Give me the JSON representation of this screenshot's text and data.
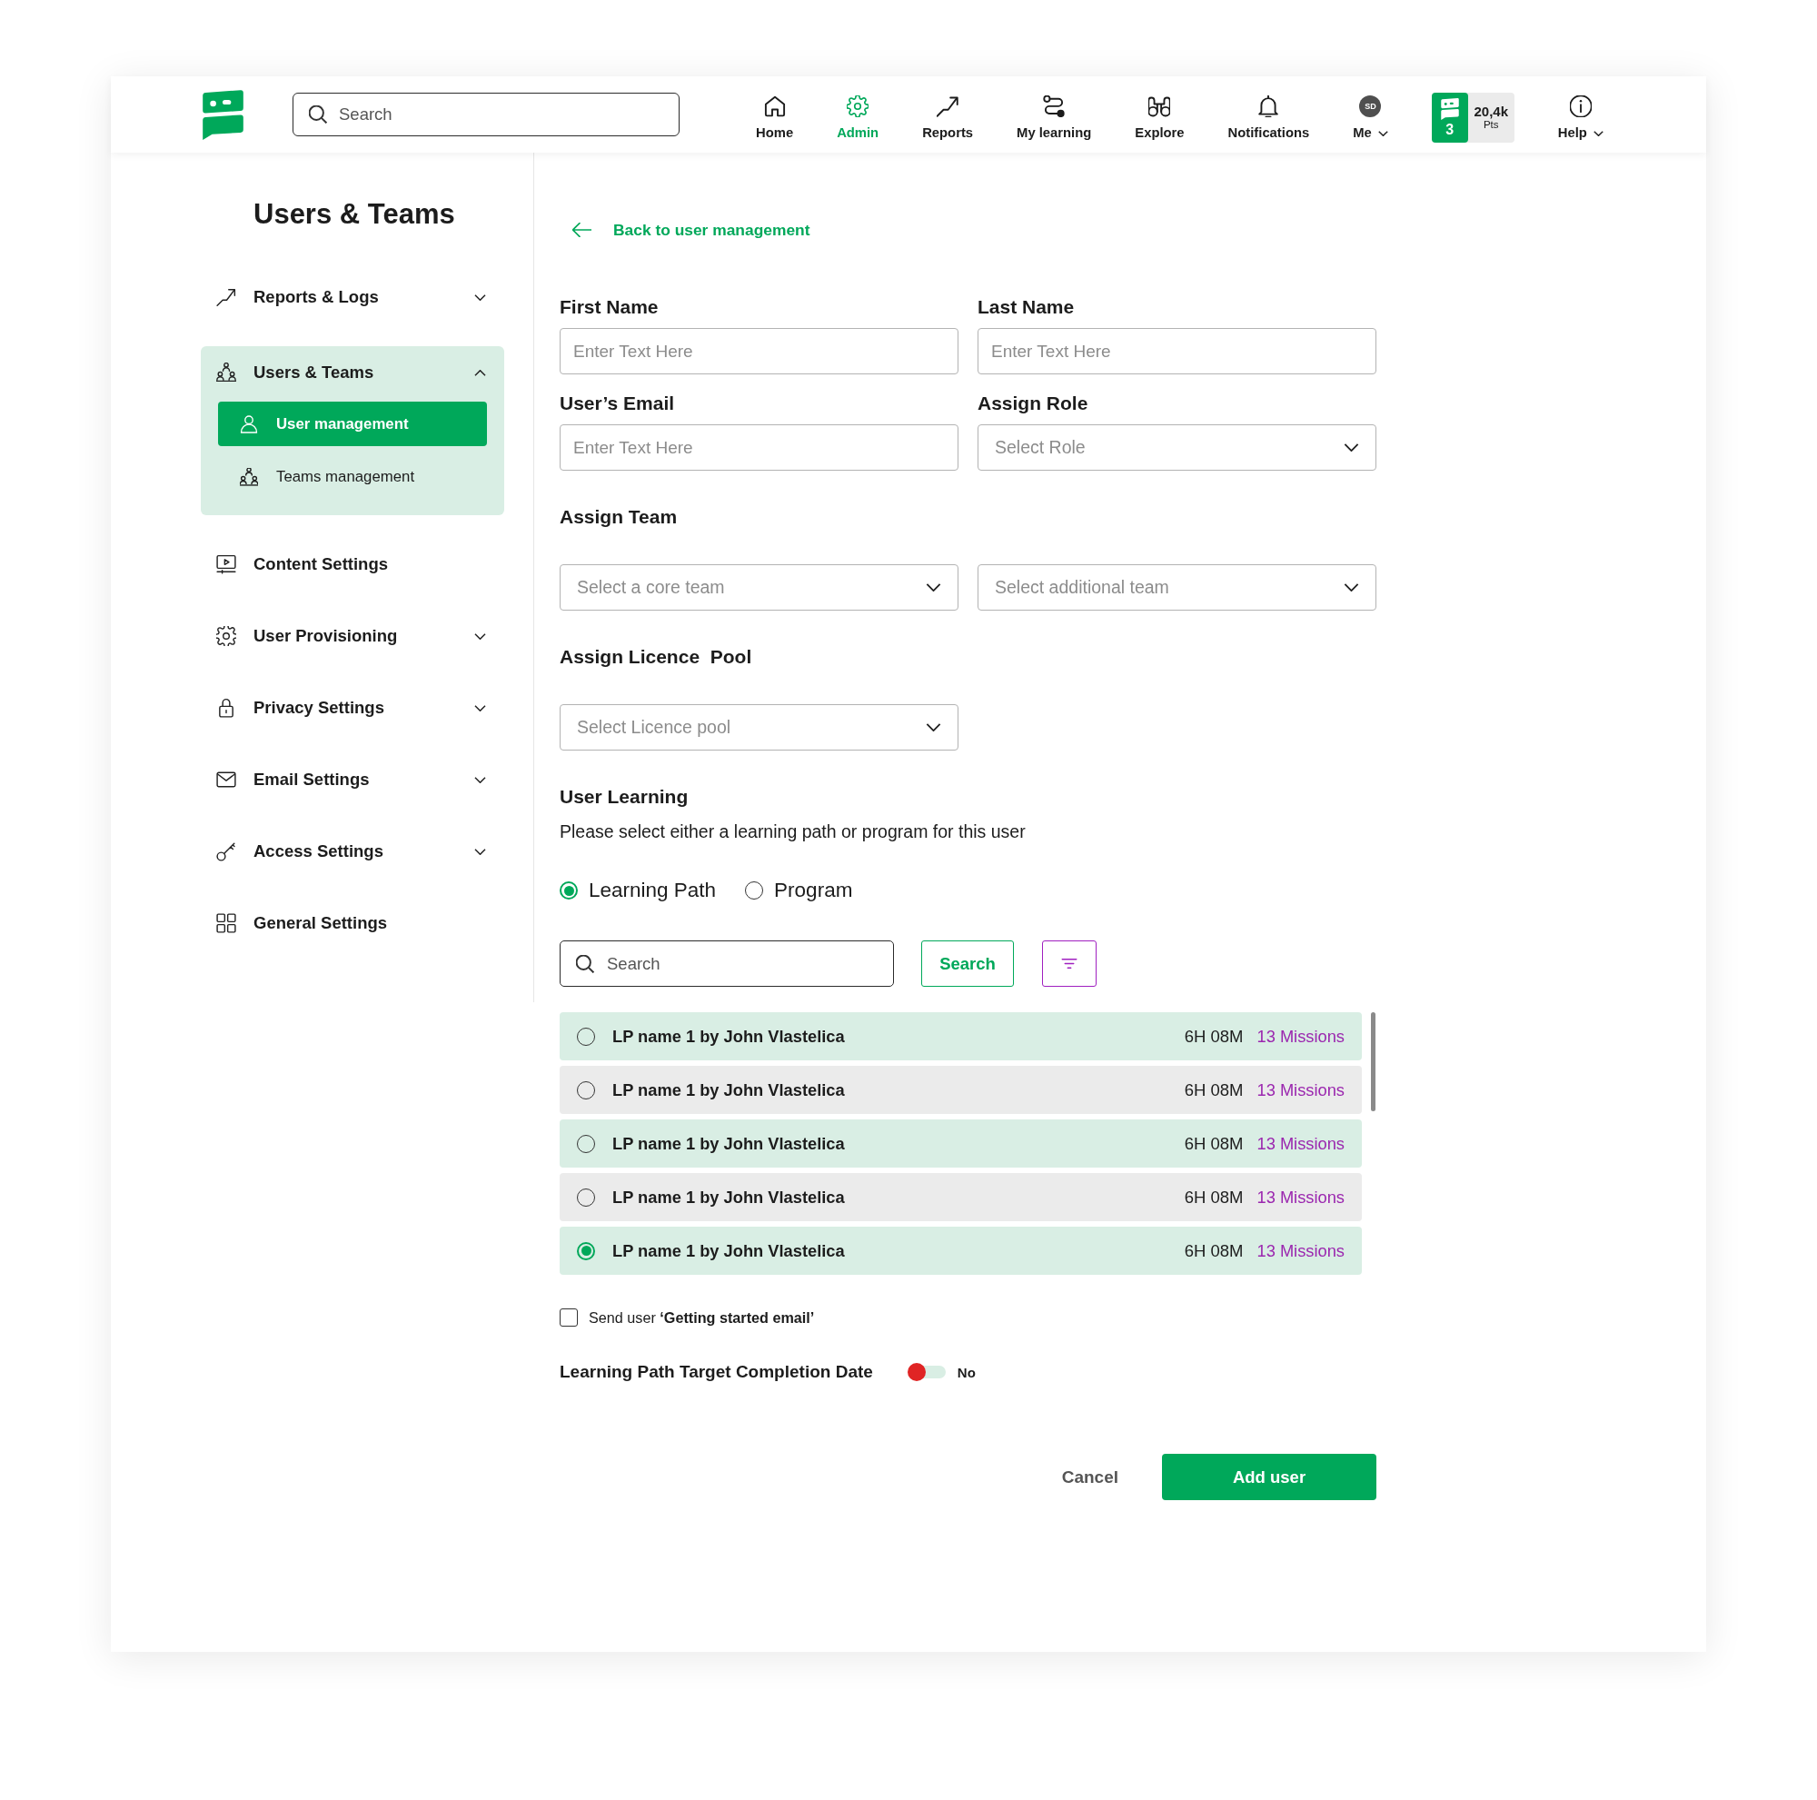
{
  "header": {
    "search": {
      "placeholder": "Search"
    },
    "nav": [
      {
        "label": "Home",
        "kind": "icon",
        "selected": false,
        "dropdown": false
      },
      {
        "label": "Admin",
        "kind": "icon",
        "selected": true,
        "dropdown": false
      },
      {
        "label": "Reports",
        "kind": "icon",
        "selected": false,
        "dropdown": false
      },
      {
        "label": "My learning",
        "kind": "icon",
        "selected": false,
        "dropdown": false
      },
      {
        "label": "Explore",
        "kind": "icon",
        "selected": false,
        "dropdown": false
      },
      {
        "label": "Notifications",
        "kind": "icon",
        "selected": false,
        "dropdown": false
      },
      {
        "label": "Me",
        "kind": "avatar",
        "initials": "SD",
        "selected": false,
        "dropdown": true
      }
    ],
    "points": {
      "badge": "3",
      "value": "20,4k",
      "unit": "Pts"
    },
    "help": {
      "label": "Help",
      "selected": false,
      "dropdown": true
    }
  },
  "sidebar": {
    "title": "Users & Teams",
    "items": [
      {
        "label": "Reports & Logs",
        "expandable": true,
        "expanded": false
      },
      {
        "label": "Users & Teams",
        "expandable": true,
        "expanded": true,
        "children": [
          {
            "label": "User management",
            "selected": true
          },
          {
            "label": "Teams management",
            "selected": false
          }
        ]
      },
      {
        "label": "Content Settings",
        "expandable": false,
        "expanded": false
      },
      {
        "label": "User Provisioning",
        "expandable": true,
        "expanded": false
      },
      {
        "label": "Privacy Settings",
        "expandable": true,
        "expanded": false
      },
      {
        "label": "Email Settings",
        "expandable": true,
        "expanded": false
      },
      {
        "label": "Access Settings",
        "expandable": true,
        "expanded": false
      },
      {
        "label": "General Settings",
        "expandable": false,
        "expanded": false
      }
    ]
  },
  "back_link": {
    "label": "Back to user management"
  },
  "form": {
    "fields": [
      {
        "label": "First Name",
        "kind": "text",
        "placeholder": "Enter Text Here"
      },
      {
        "label": "Last Name",
        "kind": "text",
        "placeholder": "Enter Text Here"
      },
      {
        "label": "User’s Email",
        "kind": "text",
        "placeholder": "Enter Text Here"
      },
      {
        "label": "Assign Role",
        "kind": "select",
        "placeholder": "Select Role"
      }
    ],
    "team": {
      "label": "Assign Team",
      "selects": [
        {
          "placeholder": "Select a core team"
        },
        {
          "placeholder": "Select additional team"
        }
      ]
    },
    "licence": {
      "label": "Assign Licence  Pool",
      "selects": [
        {
          "placeholder": "Select Licence pool"
        }
      ]
    }
  },
  "learning": {
    "title": "User Learning",
    "description": "Please select either a learning path or program for this user",
    "types": [
      {
        "label": "Learning Path",
        "selected": true
      },
      {
        "label": "Program",
        "selected": false
      }
    ],
    "search": {
      "placeholder": "Search",
      "button": "Search"
    },
    "paths": [
      {
        "name": "LP name 1 by John Vlastelica",
        "duration": "6H 08M",
        "missions": "13 Missions",
        "selected": false
      },
      {
        "name": "LP name 1 by John Vlastelica",
        "duration": "6H 08M",
        "missions": "13 Missions",
        "selected": false
      },
      {
        "name": "LP name 1 by John Vlastelica",
        "duration": "6H 08M",
        "missions": "13 Missions",
        "selected": false
      },
      {
        "name": "LP name 1 by John Vlastelica",
        "duration": "6H 08M",
        "missions": "13 Missions",
        "selected": false
      },
      {
        "name": "LP name 1 by John Vlastelica",
        "duration": "6H 08M",
        "missions": "13 Missions",
        "selected": true
      }
    ]
  },
  "email_option": {
    "label": "Send user **‘Getting started email’**",
    "checked": false
  },
  "target_date": {
    "label": "Learning Path Target Completion Date",
    "on": false,
    "value": "No"
  },
  "actions": {
    "cancel": "Cancel",
    "submit": "Add user"
  }
}
